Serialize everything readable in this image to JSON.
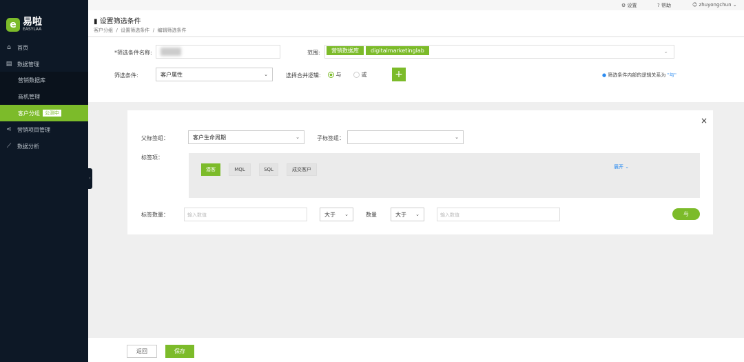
{
  "sidebar": {
    "logo_mark": "e",
    "logo_title": "易啦",
    "logo_sub": "EASYLAA",
    "items": [
      {
        "label": "首页",
        "icon": "home-icon"
      },
      {
        "label": "数据管理",
        "icon": "database-icon"
      },
      {
        "label": "营销数据库"
      },
      {
        "label": "商机管理"
      },
      {
        "label": "客户分组",
        "badge": "公测中"
      },
      {
        "label": "营销项目管理",
        "icon": "share-icon"
      },
      {
        "label": "数据分析",
        "icon": "chart-icon"
      }
    ]
  },
  "topbar": {
    "settings": "设置",
    "help": "帮助",
    "user": "zhuyongchun"
  },
  "header": {
    "title": "设置筛选条件",
    "breadcrumb": [
      "客户分组",
      "设置筛选条件",
      "编辑筛选条件"
    ]
  },
  "form": {
    "name_label": "*筛选条件名称:",
    "scope_label": "范围:",
    "scope_chips": [
      "营销数据库",
      "digitalmarketinglab"
    ],
    "cond_label": "筛选条件:",
    "cond_value": "客户属性",
    "logic_label": "选择合并逻辑:",
    "logic_and": "与",
    "logic_or": "或",
    "add": "+",
    "hint": "筛选条件内部的逻辑关系为",
    "hint_val": "\"与\""
  },
  "card": {
    "close": "×",
    "parent_label": "父标签组：",
    "parent_value": "客户生命周期",
    "child_label": "子标签组：",
    "tags_label": "标签项：",
    "tags": [
      "潜客",
      "MQL",
      "SQL",
      "成交客户"
    ],
    "expand": "展开",
    "count_label": "标签数量：",
    "count_placeholder": "输入数值",
    "op1": "大于",
    "qty_label": "数量",
    "op2": "大于",
    "qty_placeholder": "输入数值",
    "and_btn": "与"
  },
  "footer": {
    "back": "返回",
    "save": "保存"
  }
}
